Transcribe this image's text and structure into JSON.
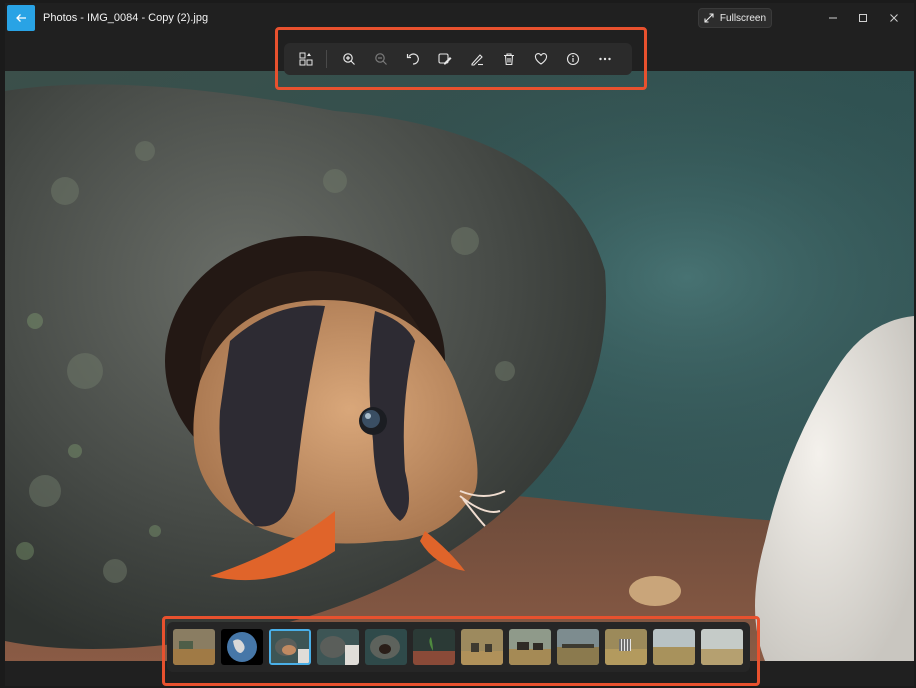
{
  "window": {
    "title": "Photos - IMG_0084 - Copy (2).jpg",
    "fullscreen_label": "Fullscreen"
  },
  "colors": {
    "accent": "#29a3e5",
    "highlight": "#e8512e",
    "selected_thumb_border": "#4ab0e8"
  },
  "toolbar": {
    "items": [
      {
        "name": "view-all-icon"
      },
      {
        "name": "zoom-in-icon"
      },
      {
        "name": "zoom-out-icon"
      },
      {
        "name": "rotate-icon"
      },
      {
        "name": "edit-image-icon"
      },
      {
        "name": "draw-icon"
      },
      {
        "name": "delete-icon"
      },
      {
        "name": "favorite-heart-icon"
      },
      {
        "name": "info-icon"
      },
      {
        "name": "more-options-icon"
      }
    ]
  },
  "filmstrip": {
    "count": 13,
    "selected_index": 2,
    "thumbnails": [
      "savanna-landscape",
      "earth-globe",
      "aquarium-fish",
      "aquarium-rock",
      "aquarium-rock-2",
      "aquarium-plant",
      "savanna-animals",
      "wildebeest-herd",
      "savanna-herd",
      "zebra-field",
      "grassland",
      "grassland-2",
      "plains"
    ]
  }
}
